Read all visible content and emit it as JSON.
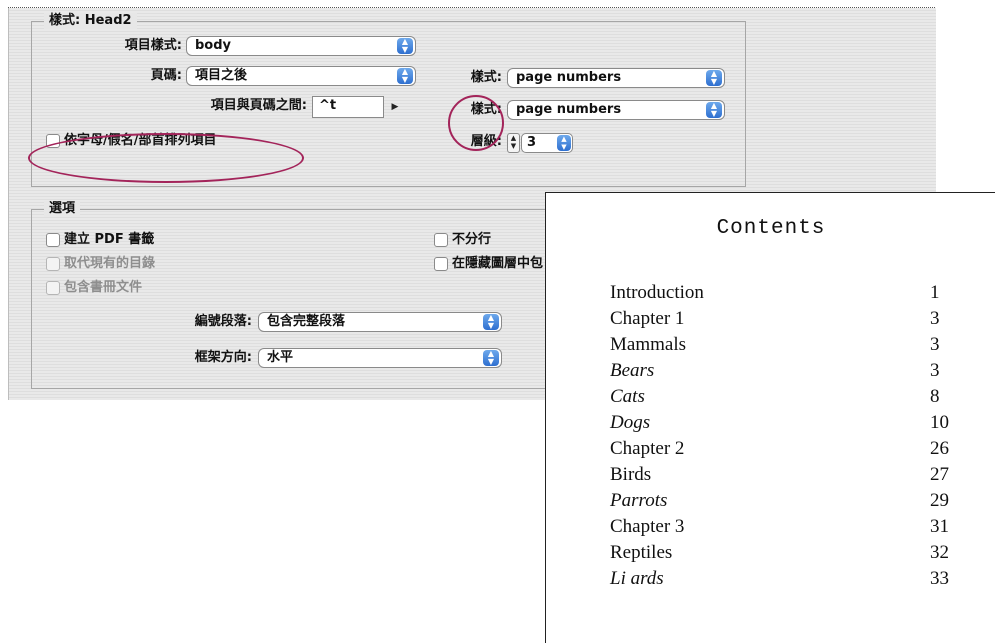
{
  "dialog": {
    "style_group": {
      "title": "樣式: Head2",
      "entry_style_label": "項目樣式:",
      "entry_style_value": "body",
      "page_number_label": "頁碼:",
      "page_number_value": "項目之後",
      "between_label": "項目與頁碼之間:",
      "between_value": "^t",
      "page_style_label_1": "樣式:",
      "page_style_value_1": "page numbers",
      "page_style_label_2": "樣式:",
      "page_style_value_2": "page numbers",
      "sort_checkbox_label": "依字母/假名/部首排列項目",
      "level_label": "層級:",
      "level_value": "3"
    },
    "options_group": {
      "title": "選項",
      "create_pdf_bookmarks": "建立 PDF 書籤",
      "replace_existing": "取代現有的目錄",
      "include_book_docs": "包含書冊文件",
      "run_in": "不分行",
      "hidden_layers": "在隱藏圖層中包",
      "numbered_paragraphs_label": "編號段落:",
      "numbered_paragraphs_value": "包含完整段落",
      "frame_direction_label": "框架方向:",
      "frame_direction_value": "水平"
    },
    "highlight_color": "#a3245a"
  },
  "toc_preview": {
    "title": "Contents",
    "entries": [
      {
        "title": "Introduction",
        "page": "1",
        "italic": false
      },
      {
        "title": "Chapter 1",
        "page": "3",
        "italic": false
      },
      {
        "title": "Mammals",
        "page": "3",
        "italic": false
      },
      {
        "title": "Bears",
        "page": "3",
        "italic": true
      },
      {
        "title": "Cats",
        "page": "8",
        "italic": true
      },
      {
        "title": "Dogs",
        "page": "10",
        "italic": true
      },
      {
        "title": "Chapter 2",
        "page": "26",
        "italic": false
      },
      {
        "title": "Birds",
        "page": "27",
        "italic": false
      },
      {
        "title": "Parrots",
        "page": "29",
        "italic": true
      },
      {
        "title": "Chapter 3",
        "page": "31",
        "italic": false
      },
      {
        "title": "Reptiles",
        "page": "32",
        "italic": false
      },
      {
        "title": "Li ards",
        "page": "33",
        "italic": true
      }
    ]
  }
}
